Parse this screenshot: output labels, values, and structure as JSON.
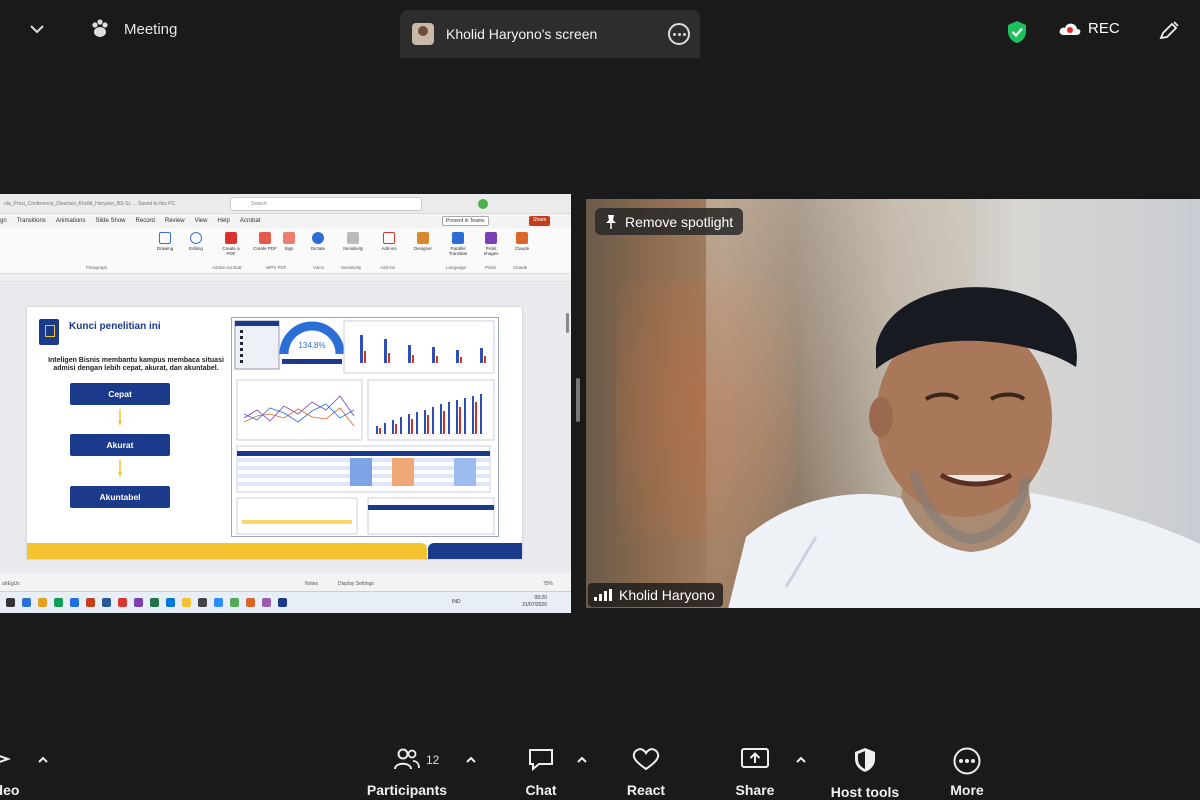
{
  "topbar": {
    "meeting_label": "Meeting",
    "share_tab_title": "Kholid Haryono's screen",
    "rec_label": "REC",
    "shield_color": "#1fbf5b"
  },
  "shared_screen": {
    "window_title": "ula_Presi_Conference_Disertasi_Kholid_Haryono_BS-Sc ... Saved to this PC",
    "search_placeholder": "Search",
    "menu": [
      "gn",
      "Transitions",
      "Animations",
      "Slide Show",
      "Record",
      "Review",
      "View",
      "Help",
      "Acrobat"
    ],
    "present_label": "Present in Teams",
    "share_label": "Share",
    "ribbon_buttons": [
      "Drawing",
      "Editing",
      "Create a PDF",
      "Create PDF",
      "Sign",
      "Dictate",
      "Sensitivity",
      "Add-ins",
      "Designer",
      "Parallel Translate",
      "Pickit Images",
      "Claude"
    ],
    "ribbon_groups": [
      "Paragraph",
      "Adobe Acrobat",
      "WPS PDF",
      "Voice",
      "Sensitivity",
      "Add-ins",
      "Language",
      "Pickit",
      "Claude"
    ],
    "slide": {
      "title": "Kunci penelitian ini",
      "body": "Inteligen Bisnis membantu kampus membaca situasi admisi dengan lebih cepat, akurat, dan akuntabel.",
      "steps": [
        "Cepat",
        "Akurat",
        "Akuntabel"
      ],
      "gauge_value": "134.8%"
    },
    "status": {
      "left": "ahEgUs",
      "notes": "Notes",
      "display": "Display Settings",
      "zoom": "75%"
    },
    "taskbar": {
      "lang": "IND",
      "time": "09:20",
      "date": "31/07/2026"
    }
  },
  "video": {
    "spotlight_label": "Remove spotlight",
    "participant_name": "Kholid Haryono"
  },
  "toolbar": {
    "video_label": "deo",
    "participants_label": "Participants",
    "participants_count": "12",
    "chat_label": "Chat",
    "react_label": "React",
    "share_label": "Share",
    "host_tools_label": "Host tools",
    "more_label": "More"
  }
}
